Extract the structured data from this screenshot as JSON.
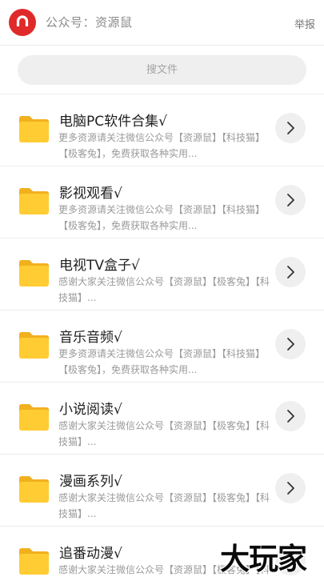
{
  "header": {
    "account_label": "公众号：资源鼠",
    "report_label": "举报",
    "avatar_icon": "magnet-icon",
    "avatar_color": "#e02a2a"
  },
  "search": {
    "placeholder": "搜文件"
  },
  "colors": {
    "folder": "#ffcc33",
    "folder_tab": "#f2b01e",
    "arrow_bg": "#efefef",
    "desc_text": "#9a9a9a"
  },
  "items": [
    {
      "title": "电脑PC软件合集√",
      "desc": "更多资源请关注微信公众号【资源鼠】【科技猫】【极客兔】，免费获取各种实用..."
    },
    {
      "title": "影视观看√",
      "desc": "更多资源请关注微信公众号【资源鼠】【科技猫】【极客兔】，免费获取各种实用..."
    },
    {
      "title": "电视TV盒子√",
      "desc": "感谢大家关注微信公众号【资源鼠】【极客兔】【科技猫】..."
    },
    {
      "title": "音乐音频√",
      "desc": "更多资源请关注微信公众号【资源鼠】【科技猫】【极客兔】，免费获取各种实用..."
    },
    {
      "title": "小说阅读√",
      "desc": "感谢大家关注微信公众号【资源鼠】【极客兔】【科技猫】..."
    },
    {
      "title": "漫画系列√",
      "desc": "感谢大家关注微信公众号【资源鼠】【极客兔】【科技猫】..."
    },
    {
      "title": "追番动漫√",
      "desc": "感谢大家关注微信公众号【资源鼠】【极客兔】【科技猫】..."
    }
  ],
  "watermark": "大玩家"
}
